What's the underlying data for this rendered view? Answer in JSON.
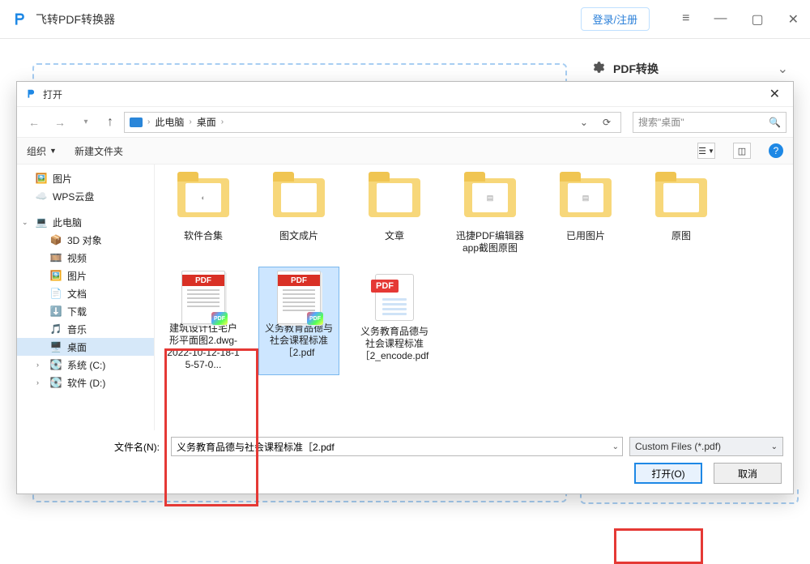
{
  "app": {
    "title": "飞转PDF转换器",
    "login_label": "登录/注册"
  },
  "right_panel": {
    "title": "PDF转换"
  },
  "dialog": {
    "title": "打开",
    "breadcrumb": {
      "a": "此电脑",
      "b": "桌面"
    },
    "search_placeholder": "搜索\"桌面\"",
    "toolbar": {
      "organize": "组织",
      "new_folder": "新建文件夹"
    },
    "tree": {
      "pictures": "图片",
      "wps": "WPS云盘",
      "this_pc": "此电脑",
      "obj3d": "3D 对象",
      "videos": "视频",
      "pictures2": "图片",
      "documents": "文档",
      "downloads": "下载",
      "music": "音乐",
      "desktop": "桌面",
      "sysc": "系统 (C:)",
      "softd": "软件 (D:)"
    },
    "files": {
      "row1": [
        "软件合集",
        "图文成片",
        "文章",
        "迅捷PDF编辑器app截图原图",
        "已用图片",
        "原图"
      ],
      "pdf_thumb_name": "建筑设计住宅户形平面图2.dwg-2022-10-12-18-15-57-0...",
      "pdf_sel": "义务教育品德与社会课程标准［2.pdf",
      "pdf_other": "义务教育品德与社会课程标准［2_encode.pdf"
    },
    "footer": {
      "filename_label": "文件名(N):",
      "filename_value": "义务教育品德与社会课程标准［2.pdf",
      "filter_label": "Custom Files (*.pdf)",
      "open_btn": "打开(O)",
      "cancel_btn": "取消"
    }
  }
}
